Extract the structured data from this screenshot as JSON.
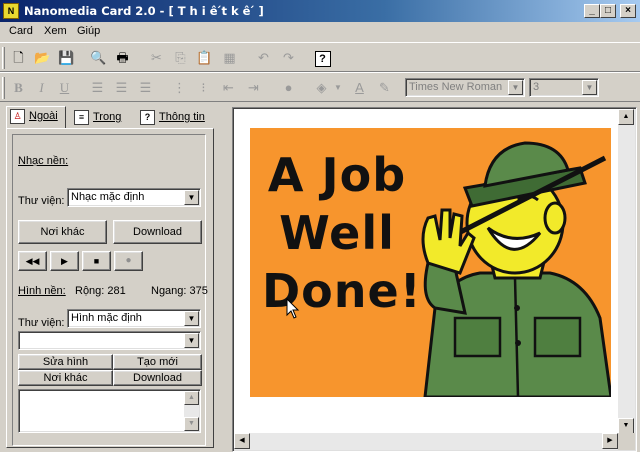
{
  "window": {
    "title": "Nanomedia Card 2.0 - [ T h i ê ́t  k ê ́ ]"
  },
  "menu": [
    "Card",
    "Xem",
    "Giúp"
  ],
  "format_toolbar": {
    "font_name": "Times New Roman",
    "font_size": "3"
  },
  "tabs": [
    {
      "label": "Ngoài",
      "icon": "person-icon"
    },
    {
      "label": "Trong",
      "icon": "page-icon"
    },
    {
      "label": "Thông tin",
      "icon": "help-icon"
    }
  ],
  "music": {
    "heading": "Nhạc nền:",
    "library_label": "Thư viện:",
    "library_value": "Nhạc mặc định",
    "other_button": "Nơi khác",
    "download_button": "Download"
  },
  "image": {
    "heading": "Hình nền:",
    "width_text": "Rộng: 281",
    "height_text": "Ngang: 375",
    "library_label": "Thư viện:",
    "library_value": "Hình mặc định",
    "edit_button": "Sửa hình",
    "new_button": "Tạo mới",
    "other_button": "Nơi khác",
    "download_button": "Download"
  },
  "card": {
    "line1": "A Job",
    "line2": "Well",
    "line3": "Done!"
  },
  "colors": {
    "card_background": "#f7952d",
    "soldier_skin": "#f2ea2a",
    "uniform": "#5a8a4a"
  }
}
